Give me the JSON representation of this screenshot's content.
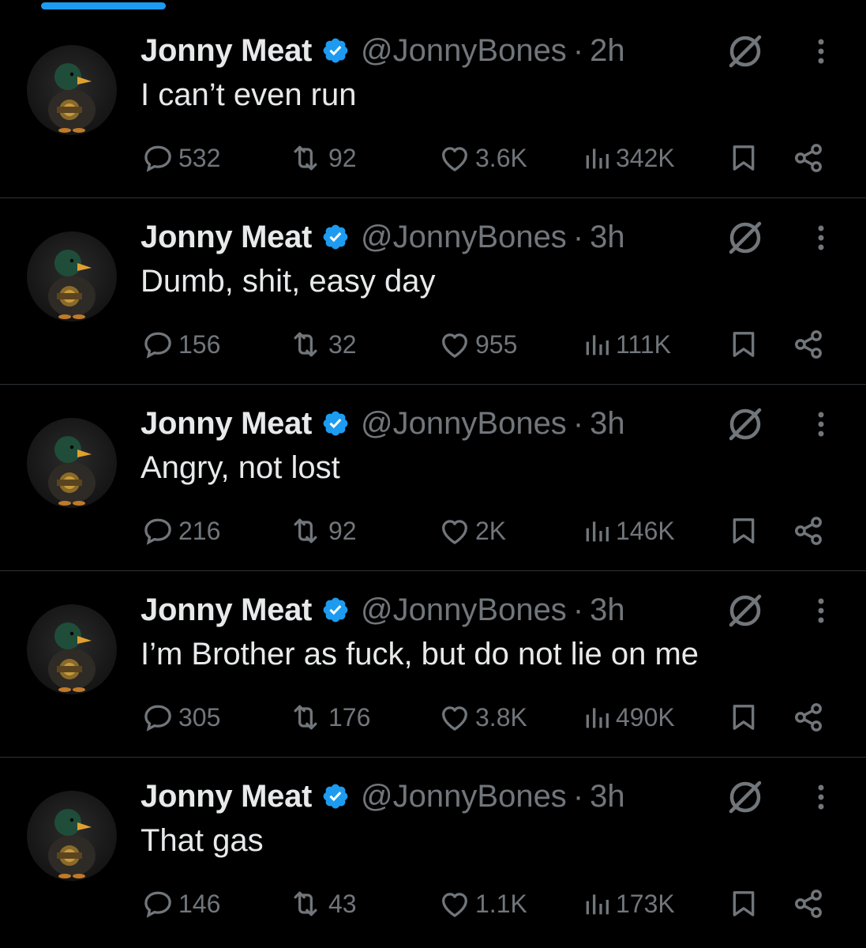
{
  "colors": {
    "background": "#000000",
    "primary_text": "#e7e9ea",
    "secondary_text": "#71767b",
    "verified": "#1d9bf0",
    "divider": "#2f3336"
  },
  "tweets": [
    {
      "name": "Jonny Meat",
      "handle": "@JonnyBones",
      "dot": "·",
      "time": "2h",
      "text": "I can’t even run",
      "replies": "532",
      "retweets": "92",
      "likes": "3.6K",
      "views": "342K"
    },
    {
      "name": "Jonny Meat",
      "handle": "@JonnyBones",
      "dot": "·",
      "time": "3h",
      "text": "Dumb, shit, easy day",
      "replies": "156",
      "retweets": "32",
      "likes": "955",
      "views": "111K"
    },
    {
      "name": "Jonny Meat",
      "handle": "@JonnyBones",
      "dot": "·",
      "time": "3h",
      "text": "Angry, not lost",
      "replies": "216",
      "retweets": "92",
      "likes": "2K",
      "views": "146K"
    },
    {
      "name": "Jonny Meat",
      "handle": "@JonnyBones",
      "dot": "·",
      "time": "3h",
      "text": "I’m Brother as fuck, but do not lie on me",
      "replies": "305",
      "retweets": "176",
      "likes": "3.8K",
      "views": "490K"
    },
    {
      "name": "Jonny Meat",
      "handle": "@JonnyBones",
      "dot": "·",
      "time": "3h",
      "text": "That gas",
      "replies": "146",
      "retweets": "43",
      "likes": "1.1K",
      "views": "173K"
    }
  ],
  "icons": {
    "avatar": "duck-avatar-icon",
    "verified": "verified-badge-icon",
    "grok": "grok-icon",
    "more": "more-vertical-icon",
    "reply": "reply-icon",
    "retweet": "retweet-icon",
    "like": "heart-icon",
    "views": "views-icon",
    "bookmark": "bookmark-icon",
    "share": "share-icon"
  }
}
